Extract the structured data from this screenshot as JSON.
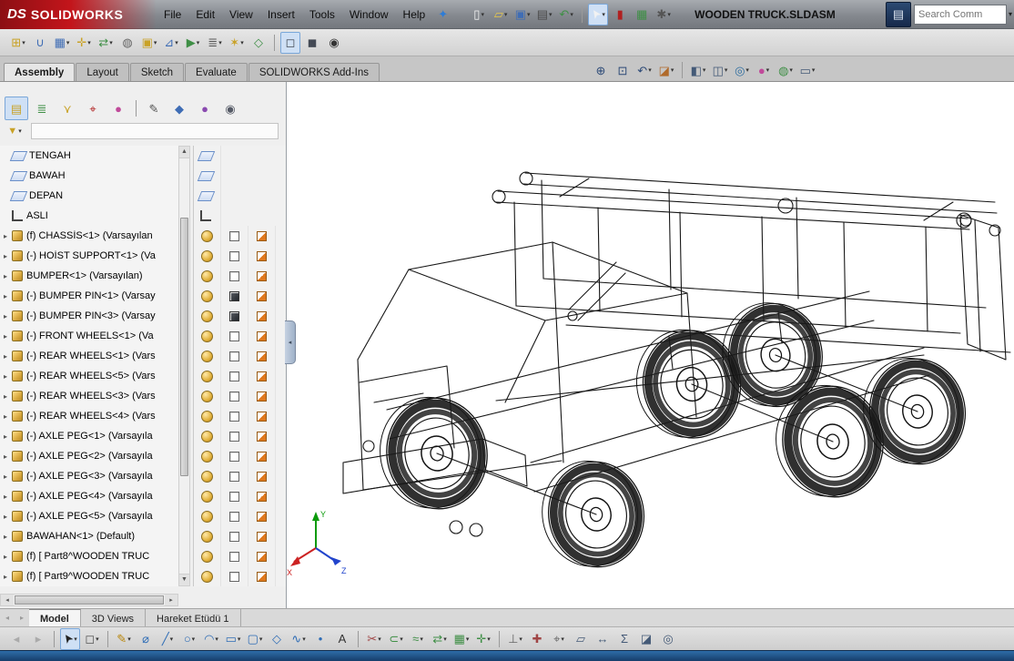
{
  "titlebar": {
    "brand_prefix": "DS",
    "brand": "SOLIDWORKS",
    "menus": [
      "File",
      "Edit",
      "View",
      "Insert",
      "Tools",
      "Window",
      "Help"
    ],
    "document_title": "WOODEN TRUCK.SLDASM",
    "search": {
      "placeholder": "Search Comm"
    },
    "quick_access_icons": [
      {
        "n": "new-document-icon",
        "g": "▯",
        "c": "#f5f5f5",
        "dd": true
      },
      {
        "n": "open-icon",
        "g": "▱",
        "c": "#e8c84a",
        "dd": true
      },
      {
        "n": "save-icon",
        "g": "▣",
        "c": "#3f6db5",
        "dd": true
      },
      {
        "n": "print-icon",
        "g": "▤",
        "c": "#4a4a4a",
        "dd": true
      },
      {
        "n": "undo-icon",
        "g": "↶",
        "c": "#3f8f46",
        "dd": true
      },
      {
        "sep": true
      },
      {
        "n": "select-icon",
        "g": "➤",
        "c": "#f2f2f2",
        "rot": -125,
        "dd": true,
        "on": true
      },
      {
        "n": "mouse-gestures-icon",
        "g": "▮",
        "c": "#b02020"
      },
      {
        "n": "evaluate-table-icon",
        "g": "▦",
        "c": "#3f8f46"
      },
      {
        "n": "options-icon",
        "g": "✱",
        "c": "#555555",
        "dd": true
      }
    ]
  },
  "assembly_toolbar_icons": [
    {
      "n": "insert-components-icon",
      "g": "⊞",
      "c": "#c9a227",
      "dd": true
    },
    {
      "n": "mate-icon",
      "g": "∪",
      "c": "#3f6db5"
    },
    {
      "n": "linear-component-pattern-icon",
      "g": "▦",
      "c": "#3f6db5",
      "dd": true
    },
    {
      "n": "smart-fasteners-icon",
      "g": "✛",
      "c": "#c9a227",
      "dd": true
    },
    {
      "n": "move-component-icon",
      "g": "⇄",
      "c": "#3f8f46",
      "dd": true
    },
    {
      "n": "show-hidden-components-icon",
      "g": "◍",
      "c": "#666666"
    },
    {
      "n": "assembly-features-icon",
      "g": "▣",
      "c": "#c9a227",
      "dd": true
    },
    {
      "n": "reference-geometry-icon",
      "g": "⊿",
      "c": "#3f6db5",
      "dd": true
    },
    {
      "n": "new-motion-study-icon",
      "g": "▶",
      "c": "#3f8f46",
      "dd": true
    },
    {
      "n": "bill-of-materials-icon",
      "g": "≣",
      "c": "#555555",
      "dd": true
    },
    {
      "n": "exploded-view-icon",
      "g": "✶",
      "c": "#c9a227",
      "dd": true
    },
    {
      "n": "instant3d-icon",
      "g": "◇",
      "c": "#3f8f46"
    },
    {
      "sep": true
    },
    {
      "n": "wireframe-display-icon",
      "g": "◻",
      "c": "#444a55",
      "on": true
    },
    {
      "n": "shaded-display-icon",
      "g": "◼",
      "c": "#444a55"
    },
    {
      "n": "take-snapshot-icon",
      "g": "◉",
      "c": "#333333"
    }
  ],
  "ribbon_tabs": {
    "items": [
      "Assembly",
      "Layout",
      "Sketch",
      "Evaluate",
      "SOLIDWORKS Add-Ins"
    ],
    "active_index": 0
  },
  "headsup_icons": [
    {
      "n": "zoom-to-fit-icon",
      "g": "⊕",
      "c": "#2d4a77"
    },
    {
      "n": "zoom-to-area-icon",
      "g": "⊡",
      "c": "#2d4a77"
    },
    {
      "n": "previous-view-icon",
      "g": "↶",
      "c": "#2d4a77",
      "dd": true
    },
    {
      "n": "section-view-icon",
      "g": "◪",
      "c": "#b06a2a",
      "dd": true
    },
    {
      "sep": true
    },
    {
      "n": "view-orientation-icon",
      "g": "◧",
      "c": "#445a77",
      "dd": true
    },
    {
      "n": "display-style-icon",
      "g": "◫",
      "c": "#445a77",
      "dd": true
    },
    {
      "n": "hide-show-items-icon",
      "g": "◎",
      "c": "#2d6da0",
      "dd": true
    },
    {
      "n": "edit-appearance-icon",
      "g": "●",
      "c": "#c04a9a",
      "dd": true
    },
    {
      "n": "apply-scene-icon",
      "g": "◍",
      "c": "#3f8f46",
      "dd": true
    },
    {
      "n": "view-settings-icon",
      "g": "▭",
      "c": "#445a77",
      "dd": true
    }
  ],
  "fm_tab_icons": [
    {
      "n": "featuremanager-tree-icon",
      "g": "▤",
      "c": "#c9a227",
      "on": true
    },
    {
      "n": "propertymanager-icon",
      "g": "≣",
      "c": "#3f8f46"
    },
    {
      "n": "configurationmanager-icon",
      "g": "⋎",
      "c": "#c9a227"
    },
    {
      "n": "dimxpertmanager-icon",
      "g": "⌖",
      "c": "#b02020"
    },
    {
      "n": "displaymanager-icon",
      "g": "●",
      "c": "#c04a9a"
    },
    {
      "sep": true
    },
    {
      "n": "pencil-icon",
      "g": "✎",
      "c": "#555555"
    },
    {
      "n": "solid-body-icon",
      "g": "◆",
      "c": "#3f6db5"
    },
    {
      "n": "appearance-tab-icon",
      "g": "●",
      "c": "#8a4ab0"
    },
    {
      "n": "eye-icon",
      "g": "◉",
      "c": "#555a66"
    }
  ],
  "feature_tree": {
    "rows": [
      {
        "t": "plane",
        "dp": "plane",
        "label": "TENGAH"
      },
      {
        "t": "plane",
        "dp": "plane",
        "label": "BAWAH"
      },
      {
        "t": "plane",
        "dp": "plane",
        "label": "DEPAN"
      },
      {
        "t": "axis",
        "dp": "axis",
        "label": "ASLI"
      },
      {
        "t": "comp",
        "dp": "comp",
        "label": "(f) CHASSİS<1> (Varsayılan"
      },
      {
        "t": "comp",
        "dp": "comp",
        "label": "(-) HOİST SUPPORT<1> (Va"
      },
      {
        "t": "comp",
        "dp": "comp",
        "label": "BUMPER<1> (Varsayılan)"
      },
      {
        "t": "comp",
        "dp": "compf",
        "label": "(-) BUMPER PIN<1> (Varsay"
      },
      {
        "t": "comp",
        "dp": "compf",
        "label": "(-) BUMPER PIN<3> (Varsay"
      },
      {
        "t": "comp",
        "dp": "comp",
        "label": "(-) FRONT WHEELS<1> (Va"
      },
      {
        "t": "comp",
        "dp": "comp",
        "label": "(-) REAR WHEELS<1> (Vars"
      },
      {
        "t": "comp",
        "dp": "comp",
        "label": "(-) REAR WHEELS<5> (Vars"
      },
      {
        "t": "comp",
        "dp": "comp",
        "label": "(-) REAR WHEELS<3> (Vars"
      },
      {
        "t": "comp",
        "dp": "comp",
        "label": "(-) REAR WHEELS<4> (Vars"
      },
      {
        "t": "comp",
        "dp": "comp",
        "label": "(-) AXLE PEG<1> (Varsayıla"
      },
      {
        "t": "comp",
        "dp": "comp",
        "label": "(-) AXLE PEG<2> (Varsayıla"
      },
      {
        "t": "comp",
        "dp": "comp",
        "label": "(-) AXLE PEG<3> (Varsayıla"
      },
      {
        "t": "comp",
        "dp": "comp",
        "label": "(-) AXLE PEG<4> (Varsayıla"
      },
      {
        "t": "comp",
        "dp": "comp",
        "label": "(-) AXLE PEG<5> (Varsayıla"
      },
      {
        "t": "comp",
        "dp": "comp",
        "label": "BAWAHAN<1> (Default)"
      },
      {
        "t": "comp",
        "dp": "comp",
        "label": "(f) [ Part8^WOODEN TRUC"
      },
      {
        "t": "comp",
        "dp": "comp",
        "label": "(f) [ Part9^WOODEN TRUC"
      }
    ]
  },
  "viewport": {
    "triad": [
      "X",
      "Y",
      "Z"
    ]
  },
  "bottom_tabs": {
    "items": [
      "Model",
      "3D Views",
      "Hareket Etüdü 1"
    ],
    "active_index": 0
  },
  "sketch_toolbar_icons": [
    {
      "n": "tb-prev-icon",
      "g": "◂",
      "c": "#9a9a9a",
      "dim": true
    },
    {
      "n": "tb-next-icon",
      "g": "▸",
      "c": "#9a9a9a",
      "dim": true
    },
    {
      "sep": true
    },
    {
      "n": "select-tool-icon",
      "g": "➤",
      "c": "#222222",
      "rot": -125,
      "dd": true,
      "on": true
    },
    {
      "n": "box-select-icon",
      "g": "◻",
      "c": "#555555",
      "dd": true
    },
    {
      "sep": true
    },
    {
      "n": "sketch-icon",
      "g": "✎",
      "c": "#b8860b",
      "dd": true
    },
    {
      "n": "smart-dimension-icon",
      "g": "⌀",
      "c": "#2f6db6"
    },
    {
      "n": "line-icon",
      "g": "╱",
      "c": "#2f6db6",
      "dd": true
    },
    {
      "n": "circle-icon",
      "g": "○",
      "c": "#2f6db6",
      "dd": true
    },
    {
      "n": "arc-icon",
      "g": "◠",
      "c": "#2f6db6",
      "dd": true
    },
    {
      "n": "rectangle-icon",
      "g": "▭",
      "c": "#2f6db6",
      "dd": true
    },
    {
      "n": "slot-icon",
      "g": "▢",
      "c": "#2f6db6",
      "dd": true
    },
    {
      "n": "polygon-icon",
      "g": "◇",
      "c": "#2f6db6"
    },
    {
      "n": "spline-icon",
      "g": "∿",
      "c": "#2f6db6",
      "dd": true
    },
    {
      "n": "point-icon",
      "g": "•",
      "c": "#2f6db6"
    },
    {
      "n": "text-icon",
      "g": "A",
      "c": "#333333"
    },
    {
      "sep": true
    },
    {
      "n": "trim-entities-icon",
      "g": "✂",
      "c": "#a04545",
      "dd": true
    },
    {
      "n": "convert-entities-icon",
      "g": "⊂",
      "c": "#3f8f46",
      "dd": true
    },
    {
      "n": "offset-entities-icon",
      "g": "≈",
      "c": "#3f8f46",
      "dd": true
    },
    {
      "n": "mirror-entities-icon",
      "g": "⇄",
      "c": "#3f8f46",
      "dd": true
    },
    {
      "n": "linear-sketch-pattern-icon",
      "g": "▦",
      "c": "#3f8f46",
      "dd": true
    },
    {
      "n": "move-entities-icon",
      "g": "✛",
      "c": "#3f8f46",
      "dd": true
    },
    {
      "sep": true
    },
    {
      "n": "display-relations-icon",
      "g": "⊥",
      "c": "#666666",
      "dd": true
    },
    {
      "n": "repair-sketch-icon",
      "g": "✚",
      "c": "#a04545"
    },
    {
      "n": "quick-snaps-icon",
      "g": "⌖",
      "c": "#666666",
      "dd": true
    },
    {
      "n": "reference-plane-icon",
      "g": "▱",
      "c": "#445a77"
    },
    {
      "n": "measure-icon",
      "g": "↔",
      "c": "#445a77"
    },
    {
      "n": "mass-properties-icon",
      "g": "Σ",
      "c": "#445a77"
    },
    {
      "n": "section-properties-icon",
      "g": "◪",
      "c": "#445a77"
    },
    {
      "n": "sensor-icon",
      "g": "◎",
      "c": "#445a77"
    }
  ],
  "colors": {
    "accent_selection": "#cfe0f5",
    "brand_red": "#c3151b",
    "statusbar_blue": "#1d4f7e",
    "component_icon_gold": "#d9a93f",
    "display_pane_orange": "#e0791e"
  }
}
